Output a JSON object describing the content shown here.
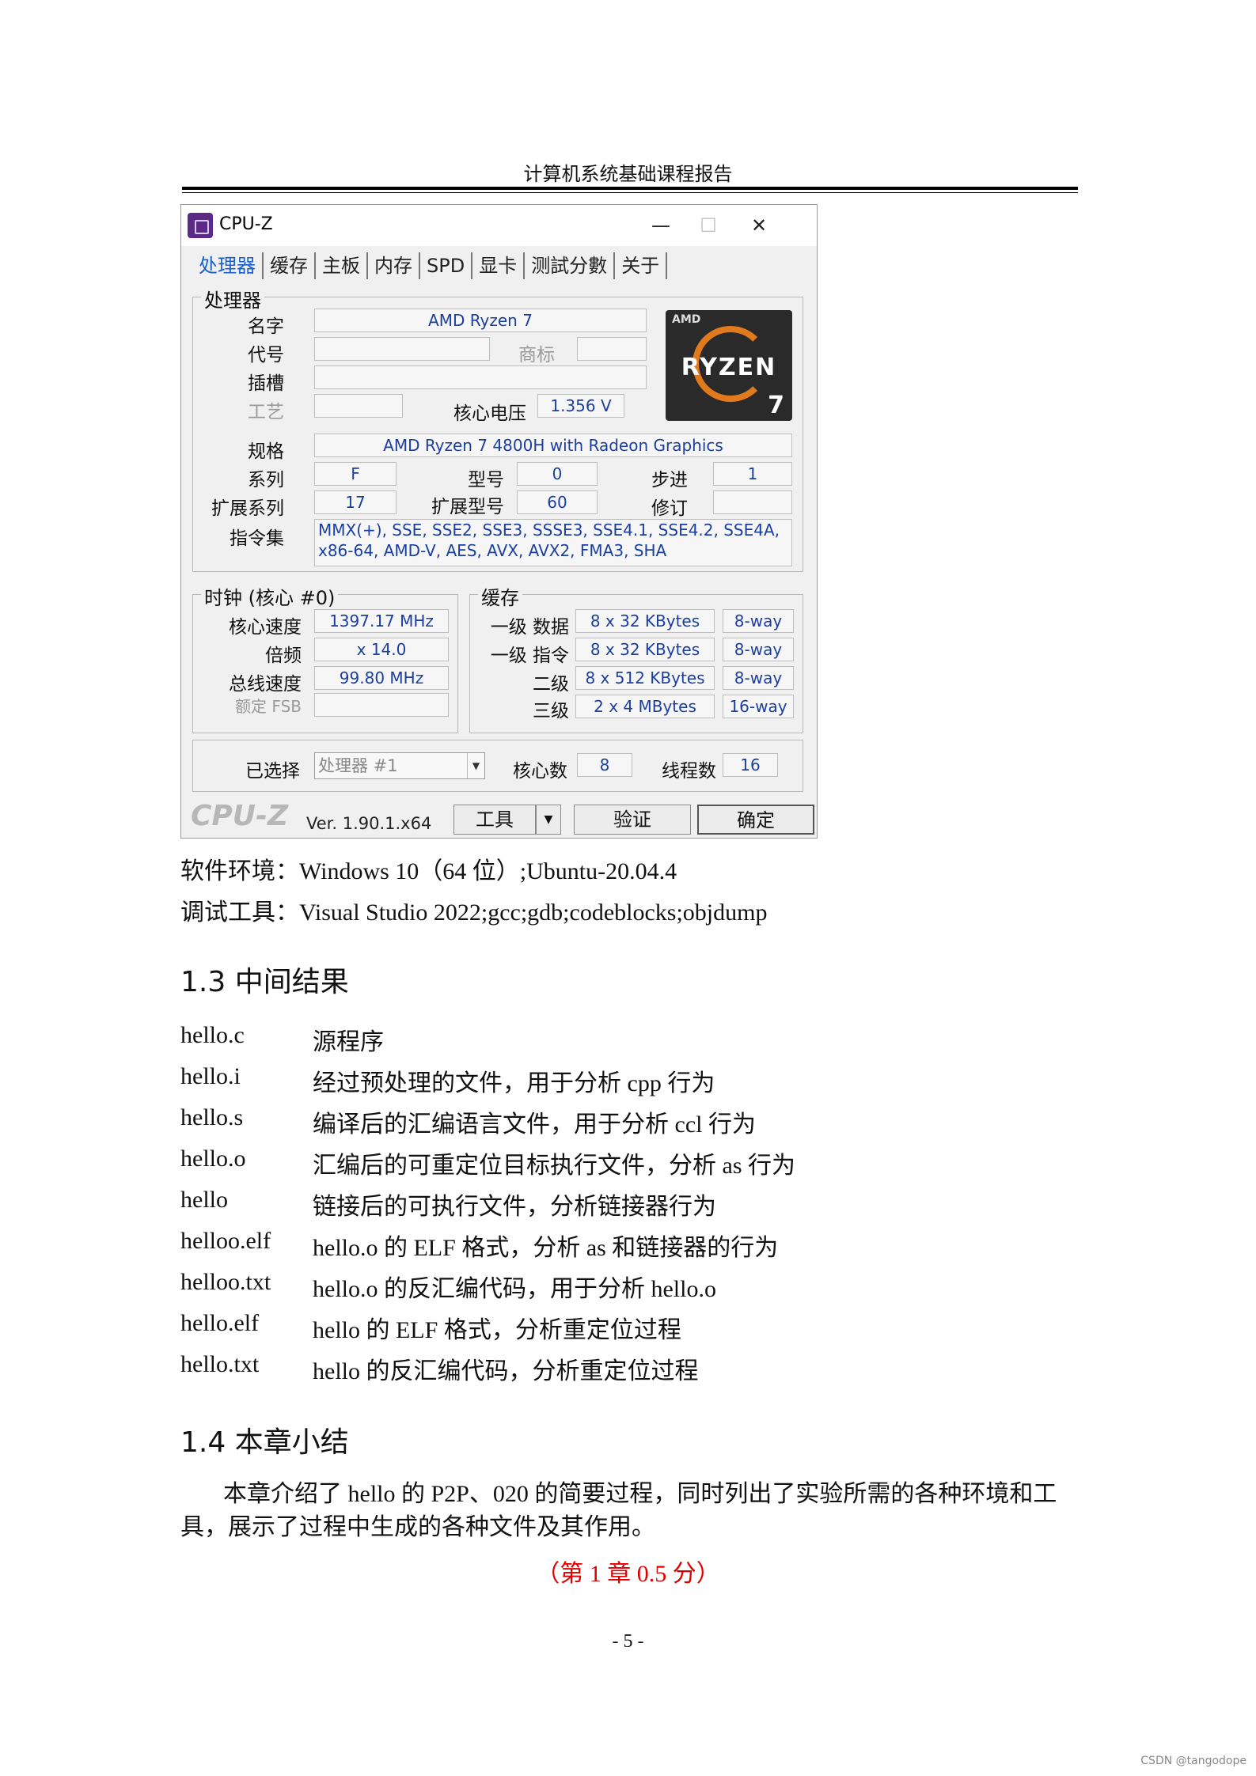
{
  "header": {
    "title": "计算机系统基础课程报告"
  },
  "cpuz": {
    "window_title": "CPU-Z",
    "controls": {
      "minimize": "—",
      "maximize": "☐",
      "close": "✕"
    },
    "tabs": [
      "处理器",
      "缓存",
      "主板",
      "内存",
      "SPD",
      "显卡",
      "测試分數",
      "关于"
    ],
    "processor_group": "处理器",
    "labels": {
      "name": "名字",
      "codename": "代号",
      "brand": "商标",
      "package": "插槽",
      "technology": "工艺",
      "core_voltage": "核心电压",
      "specification": "规格",
      "family": "系列",
      "model": "型号",
      "stepping": "步进",
      "ext_family": "扩展系列",
      "ext_model": "扩展型号",
      "revision": "修订",
      "instructions": "指令集"
    },
    "values": {
      "name": "AMD Ryzen 7",
      "core_voltage": "1.356 V",
      "specification": "AMD Ryzen 7 4800H with Radeon Graphics",
      "family": "F",
      "model": "0",
      "stepping": "1",
      "ext_family": "17",
      "ext_model": "60",
      "instructions": "MMX(+), SSE, SSE2, SSE3, SSSE3, SSE4.1, SSE4.2, SSE4A, x86-64, AMD-V, AES, AVX, AVX2, FMA3, SHA"
    },
    "logo": {
      "brand": "AMD",
      "text": "RYZEN",
      "number": "7"
    },
    "clocks": {
      "group": "时钟 (核心 #0)",
      "labels": {
        "core_speed": "核心速度",
        "multiplier": "倍频",
        "bus_speed": "总线速度",
        "rated_fsb": "额定 FSB"
      },
      "values": {
        "core_speed": "1397.17 MHz",
        "multiplier": "x 14.0",
        "bus_speed": "99.80 MHz"
      }
    },
    "cache": {
      "group": "缓存",
      "rows": [
        {
          "label": "一级 数据",
          "size": "8 x 32 KBytes",
          "way": "8-way"
        },
        {
          "label": "一级 指令",
          "size": "8 x 32 KBytes",
          "way": "8-way"
        },
        {
          "label": "二级",
          "size": "8 x 512 KBytes",
          "way": "8-way"
        },
        {
          "label": "三级",
          "size": "2 x 4 MBytes",
          "way": "16-way"
        }
      ]
    },
    "selection": {
      "label": "已选择",
      "value": "处理器 #1",
      "cores_label": "核心数",
      "cores": "8",
      "threads_label": "线程数",
      "threads": "16"
    },
    "footer": {
      "logo": "CPU-Z",
      "version": "Ver. 1.90.1.x64",
      "tools": "工具",
      "validate": "验证",
      "ok": "确定"
    }
  },
  "environment": {
    "software": "软件环境：Windows 10（64 位）;Ubuntu-20.04.4",
    "tools": "调试工具：Visual Studio 2022;gcc;gdb;codeblocks;objdump"
  },
  "section_13": {
    "title": "1.3  中间结果",
    "files": [
      {
        "name": "hello.c",
        "desc": "源程序"
      },
      {
        "name": "hello.i",
        "desc": "经过预处理的文件，用于分析 cpp 行为"
      },
      {
        "name": "hello.s",
        "desc": "编译后的汇编语言文件，用于分析 ccl 行为"
      },
      {
        "name": "hello.o",
        "desc": "汇编后的可重定位目标执行文件，分析 as 行为"
      },
      {
        "name": "hello",
        "desc": "链接后的可执行文件，分析链接器行为"
      },
      {
        "name": "helloo.elf",
        "desc": "hello.o 的 ELF 格式，分析 as 和链接器的行为"
      },
      {
        "name": "helloo.txt",
        "desc": "hello.o 的反汇编代码，用于分析 hello.o"
      },
      {
        "name": "hello.elf",
        "desc": "hello 的 ELF 格式，分析重定位过程"
      },
      {
        "name": "hello.txt",
        "desc": "hello 的反汇编代码，分析重定位过程"
      }
    ]
  },
  "section_14": {
    "title": "1.4  本章小结",
    "paragraph": "本章介绍了 hello 的 P2P、020 的简要过程，同时列出了实验所需的各种环境和工具，展示了过程中生成的各种文件及其作用。",
    "score": "（第 1 章 0.5 分）"
  },
  "page_number": "- 5 -",
  "watermark": "CSDN @tangodope",
  "colors": {
    "tab_active": "#1a5fd0",
    "field_text": "#1b3fa0",
    "score": "#e00000",
    "logo_ring": "#e07a1c"
  }
}
